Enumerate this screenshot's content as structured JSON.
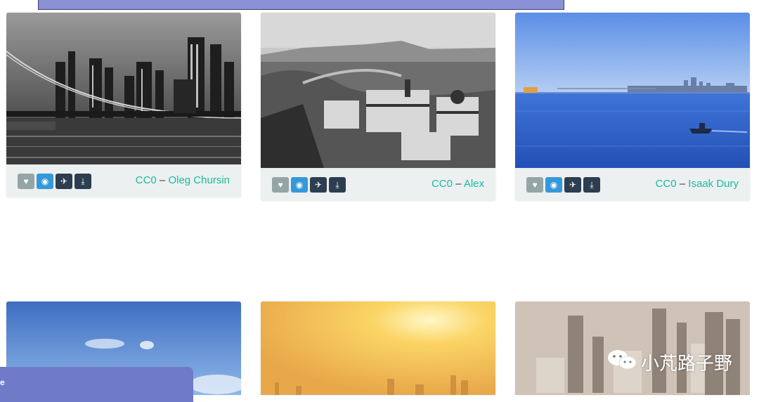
{
  "cards": [
    {
      "license": "CC0",
      "sep": " – ",
      "author": "Oleg Chursin"
    },
    {
      "license": "CC0",
      "sep": " – ",
      "author": "Alex"
    },
    {
      "license": "CC0",
      "sep": " – ",
      "author": "Isaak Dury"
    }
  ],
  "icons": {
    "like": "heart-icon",
    "view": "eye-icon",
    "tweet": "twitter-icon",
    "download": "download-icon"
  },
  "chat": {
    "label": "e"
  },
  "watermark": {
    "text": "小芃路子野",
    "icon": "wechat-icon"
  },
  "colors": {
    "accent": "#18bc9c",
    "primary": "#2c3e50",
    "info": "#3498db",
    "muted": "#95a5a6"
  }
}
